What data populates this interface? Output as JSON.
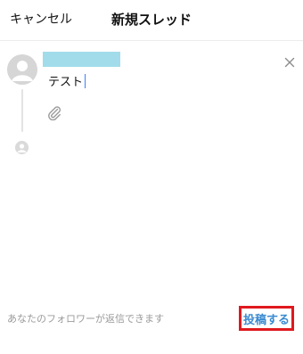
{
  "header": {
    "cancel_label": "キャンセル",
    "title": "新規スレッド"
  },
  "composer": {
    "text": "テスト",
    "icons": {
      "close": "close-icon",
      "attach": "paperclip-icon",
      "avatar": "user-avatar-icon"
    }
  },
  "footer": {
    "reply_setting": "あなたのフォロワーが返信できます",
    "post_label": "投稿する"
  },
  "colors": {
    "accent": "#3a8ad1",
    "highlight_border": "#e0191e",
    "redaction": "#a2dcea"
  }
}
